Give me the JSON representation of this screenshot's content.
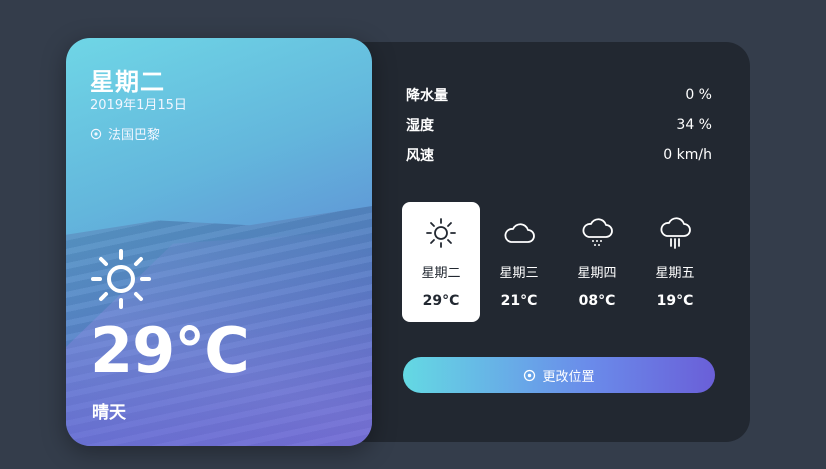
{
  "today": {
    "day_name": "星期二",
    "date": "2019年1月15日",
    "location": "法国巴黎",
    "temperature": "29°C",
    "condition": "晴天",
    "icon": "sun-icon"
  },
  "stats": [
    {
      "label": "降水量",
      "value": "0 %"
    },
    {
      "label": "湿度",
      "value": "34 %"
    },
    {
      "label": "风速",
      "value": "0 km/h"
    }
  ],
  "forecast": [
    {
      "day": "星期二",
      "temp": "29°C",
      "icon": "sun-icon",
      "active": true
    },
    {
      "day": "星期三",
      "temp": "21°C",
      "icon": "cloud-icon",
      "active": false
    },
    {
      "day": "星期四",
      "temp": "08°C",
      "icon": "snow-cloud-icon",
      "active": false
    },
    {
      "day": "星期五",
      "temp": "19°C",
      "icon": "rain-cloud-icon",
      "active": false
    }
  ],
  "button": {
    "label": "更改位置",
    "icon": "location-pin-icon"
  },
  "colors": {
    "background": "#343d4b",
    "panel": "#222831",
    "accent_start": "#64d9e3",
    "accent_end": "#6a5fd8"
  }
}
